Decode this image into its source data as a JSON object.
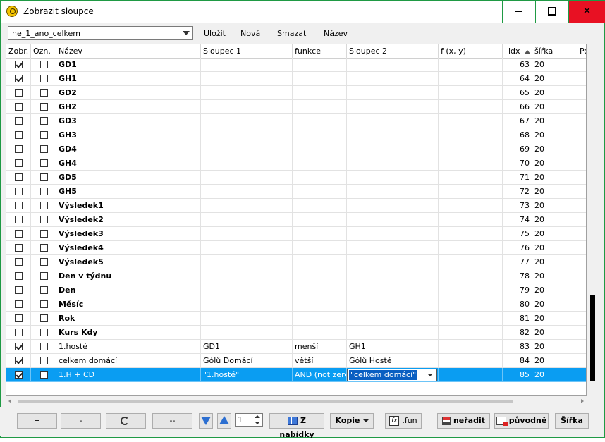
{
  "window": {
    "title": "Zobrazit sloupce"
  },
  "toolbar": {
    "preset_value": "ne_1_ano_celkem",
    "save_label": "Uložit",
    "new_label": "Nová",
    "delete_label": "Smazat",
    "name_label": "Název"
  },
  "grid": {
    "columns": [
      "Zobr.",
      "Ozn.",
      "Název",
      "Sloupec 1",
      "funkce",
      "Sloupec 2",
      "f (x, y)",
      "idx",
      "šířka",
      "Po"
    ],
    "rows": [
      {
        "show": true,
        "mark": false,
        "name": "GD1",
        "bold": true,
        "col1": "",
        "func": "",
        "col2": "",
        "fxy": "",
        "idx": "63",
        "width": "20"
      },
      {
        "show": true,
        "mark": false,
        "name": "GH1",
        "bold": true,
        "col1": "",
        "func": "",
        "col2": "",
        "fxy": "",
        "idx": "64",
        "width": "20"
      },
      {
        "show": false,
        "mark": false,
        "name": "GD2",
        "bold": true,
        "col1": "",
        "func": "",
        "col2": "",
        "fxy": "",
        "idx": "65",
        "width": "20"
      },
      {
        "show": false,
        "mark": false,
        "name": "GH2",
        "bold": true,
        "col1": "",
        "func": "",
        "col2": "",
        "fxy": "",
        "idx": "66",
        "width": "20"
      },
      {
        "show": false,
        "mark": false,
        "name": "GD3",
        "bold": true,
        "col1": "",
        "func": "",
        "col2": "",
        "fxy": "",
        "idx": "67",
        "width": "20"
      },
      {
        "show": false,
        "mark": false,
        "name": "GH3",
        "bold": true,
        "col1": "",
        "func": "",
        "col2": "",
        "fxy": "",
        "idx": "68",
        "width": "20"
      },
      {
        "show": false,
        "mark": false,
        "name": "GD4",
        "bold": true,
        "col1": "",
        "func": "",
        "col2": "",
        "fxy": "",
        "idx": "69",
        "width": "20"
      },
      {
        "show": false,
        "mark": false,
        "name": "GH4",
        "bold": true,
        "col1": "",
        "func": "",
        "col2": "",
        "fxy": "",
        "idx": "70",
        "width": "20"
      },
      {
        "show": false,
        "mark": false,
        "name": "GD5",
        "bold": true,
        "col1": "",
        "func": "",
        "col2": "",
        "fxy": "",
        "idx": "71",
        "width": "20"
      },
      {
        "show": false,
        "mark": false,
        "name": "GH5",
        "bold": true,
        "col1": "",
        "func": "",
        "col2": "",
        "fxy": "",
        "idx": "72",
        "width": "20"
      },
      {
        "show": false,
        "mark": false,
        "name": "Výsledek1",
        "bold": true,
        "col1": "",
        "func": "",
        "col2": "",
        "fxy": "",
        "idx": "73",
        "width": "20"
      },
      {
        "show": false,
        "mark": false,
        "name": "Výsledek2",
        "bold": true,
        "col1": "",
        "func": "",
        "col2": "",
        "fxy": "",
        "idx": "74",
        "width": "20"
      },
      {
        "show": false,
        "mark": false,
        "name": "Výsledek3",
        "bold": true,
        "col1": "",
        "func": "",
        "col2": "",
        "fxy": "",
        "idx": "75",
        "width": "20"
      },
      {
        "show": false,
        "mark": false,
        "name": "Výsledek4",
        "bold": true,
        "col1": "",
        "func": "",
        "col2": "",
        "fxy": "",
        "idx": "76",
        "width": "20"
      },
      {
        "show": false,
        "mark": false,
        "name": "Výsledek5",
        "bold": true,
        "col1": "",
        "func": "",
        "col2": "",
        "fxy": "",
        "idx": "77",
        "width": "20"
      },
      {
        "show": false,
        "mark": false,
        "name": "Den v týdnu",
        "bold": true,
        "col1": "",
        "func": "",
        "col2": "",
        "fxy": "",
        "idx": "78",
        "width": "20"
      },
      {
        "show": false,
        "mark": false,
        "name": "Den",
        "bold": true,
        "col1": "",
        "func": "",
        "col2": "",
        "fxy": "",
        "idx": "79",
        "width": "20"
      },
      {
        "show": false,
        "mark": false,
        "name": "Měsíc",
        "bold": true,
        "col1": "",
        "func": "",
        "col2": "",
        "fxy": "",
        "idx": "80",
        "width": "20"
      },
      {
        "show": false,
        "mark": false,
        "name": "Rok",
        "bold": true,
        "col1": "",
        "func": "",
        "col2": "",
        "fxy": "",
        "idx": "81",
        "width": "20"
      },
      {
        "show": false,
        "mark": false,
        "name": "Kurs Kdy",
        "bold": true,
        "col1": "",
        "func": "",
        "col2": "",
        "fxy": "",
        "idx": "82",
        "width": "20"
      },
      {
        "show": true,
        "mark": false,
        "name": "1.hosté",
        "bold": false,
        "col1": "GD1",
        "func": "menší",
        "col2": "GH1",
        "fxy": "",
        "idx": "83",
        "width": "20"
      },
      {
        "show": true,
        "mark": false,
        "name": "celkem domácí",
        "bold": false,
        "col1": "Gólů Domácí",
        "func": "větší",
        "col2": "Gólů Hosté",
        "fxy": "",
        "idx": "84",
        "width": "20"
      },
      {
        "show": true,
        "mark": false,
        "name": "1.H + CD",
        "bold": false,
        "col1": "\"1.hosté\"",
        "func": "AND (not zero)",
        "col2": "\"celkem domácí\"",
        "fxy": "",
        "idx": "85",
        "width": "20",
        "selected": true
      }
    ]
  },
  "bottom": {
    "add_label": "+",
    "remove_label": "-",
    "dash_label": "--",
    "spin_value": "1",
    "from_menu_label": "Z nabídky",
    "copy_label": "Kopie",
    "fun_label": ".fun",
    "unsort_label": "neřadit",
    "original_label": "původně",
    "width_label": "Šířka"
  },
  "colors": {
    "selection": "#0a9df2",
    "window_border": "#1f9a44",
    "close_bg": "#e81123"
  }
}
